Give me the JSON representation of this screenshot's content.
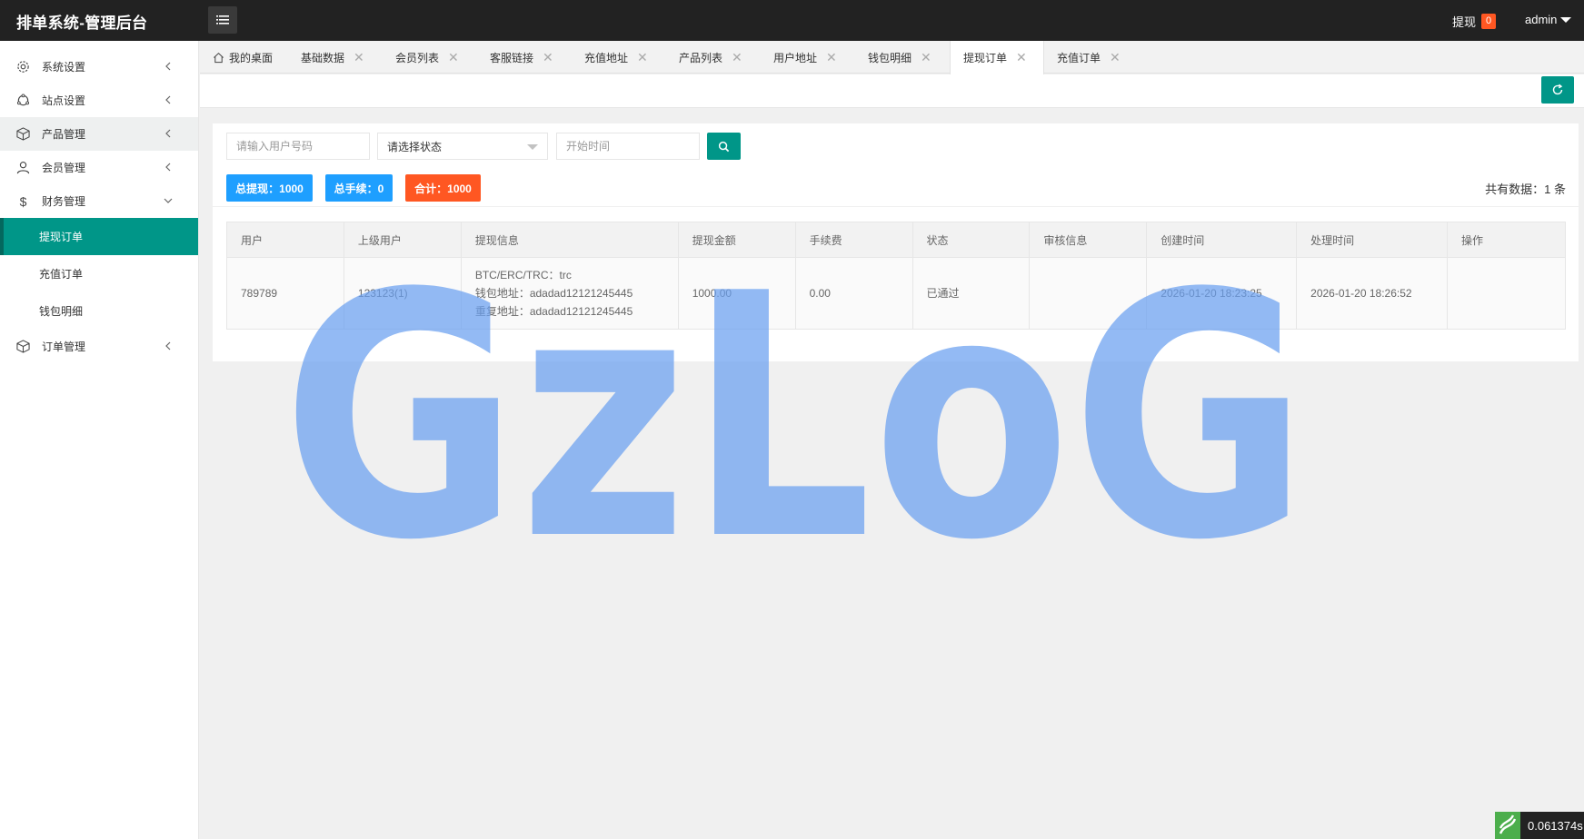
{
  "app": {
    "title": "排单系统-管理后台"
  },
  "header": {
    "withdraw_label": "提现",
    "withdraw_count": "0",
    "user": "admin"
  },
  "sidebar": {
    "items": [
      {
        "label": "系统设置",
        "icon": "gear-icon"
      },
      {
        "label": "站点设置",
        "icon": "site-icon"
      },
      {
        "label": "产品管理",
        "icon": "box-icon"
      },
      {
        "label": "会员管理",
        "icon": "user-icon"
      },
      {
        "label": "财务管理",
        "icon": "dollar-icon"
      },
      {
        "label": "订单管理",
        "icon": "box-icon"
      }
    ],
    "finance_sub": [
      "提现订单",
      "充值订单",
      "钱包明细"
    ]
  },
  "tabs": [
    {
      "label": "我的桌面"
    },
    {
      "label": "基础数据"
    },
    {
      "label": "会员列表"
    },
    {
      "label": "客服链接"
    },
    {
      "label": "充值地址"
    },
    {
      "label": "产品列表"
    },
    {
      "label": "用户地址"
    },
    {
      "label": "钱包明细"
    },
    {
      "label": "提现订单"
    },
    {
      "label": "充值订单"
    }
  ],
  "filters": {
    "user_placeholder": "请输入用户号码",
    "status_value": "请选择状态",
    "start_placeholder": "开始时间"
  },
  "stats": {
    "total_withdraw": "总提现：1000",
    "total_fee": "总手续：0",
    "total_sum": "合计：1000",
    "total_count": "共有数据：1 条"
  },
  "table": {
    "headers": [
      "用户",
      "上级用户",
      "提现信息",
      "提现金额",
      "手续费",
      "状态",
      "审核信息",
      "创建时间",
      "处理时间",
      "操作"
    ],
    "rows": [
      {
        "user": "789789",
        "parent": "123123(1)",
        "info_line1": "BTC/ERC/TRC：trc",
        "info_line2": "钱包地址：adadad12121245445",
        "info_line3": "重复地址：adadad12121245445",
        "amount": "1000.00",
        "fee": "0.00",
        "status": "已通过",
        "review": "",
        "created": "2026-01-20 18:23:25",
        "processed": "2026-01-20 18:26:52",
        "action": ""
      }
    ]
  },
  "watermark": "GzLoG",
  "footer": {
    "timing": "0.061374s"
  },
  "colors": {
    "accent": "#009688",
    "blue": "#1e9fff",
    "orange": "#ff5722",
    "header": "#222222"
  }
}
